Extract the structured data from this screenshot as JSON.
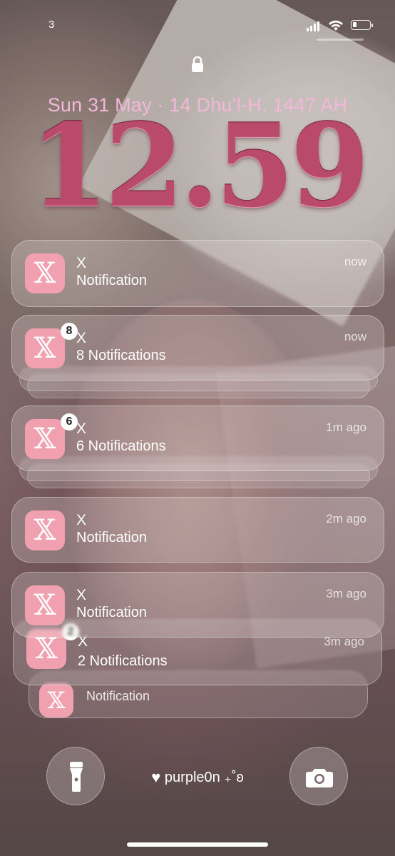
{
  "status": {
    "carrier": "3"
  },
  "lock": {
    "date": "Sun 31 May · 14 Dhuʻl-H. 1447 AH",
    "time": "12.59"
  },
  "notifications": [
    {
      "app": "X",
      "text": "Notification",
      "time": "now",
      "badge": ""
    },
    {
      "app": "X",
      "text": "8 Notifications",
      "time": "now",
      "badge": "8"
    },
    {
      "app": "X",
      "text": "6 Notifications",
      "time": "1m ago",
      "badge": "6"
    },
    {
      "app": "X",
      "text": "Notification",
      "time": "2m ago",
      "badge": ""
    },
    {
      "app": "X",
      "text": "Notification",
      "time": "3m ago",
      "badge": ""
    },
    {
      "app": "X",
      "text": "2 Notifications",
      "time": "3m ago",
      "badge": "2"
    },
    {
      "app": "X",
      "text": "Notification",
      "time": "",
      "badge": ""
    }
  ],
  "footer": {
    "owner": "purple0n ₊˚ʚ"
  },
  "icons": {
    "app": "x-logo-icon",
    "lock": "lock-icon",
    "flashlight": "flashlight-icon",
    "camera": "camera-icon",
    "heart": "heart-icon"
  },
  "colors": {
    "date": "#f2b8d9",
    "time": "#b94a6c",
    "app_icon": "#f0a0ae"
  }
}
